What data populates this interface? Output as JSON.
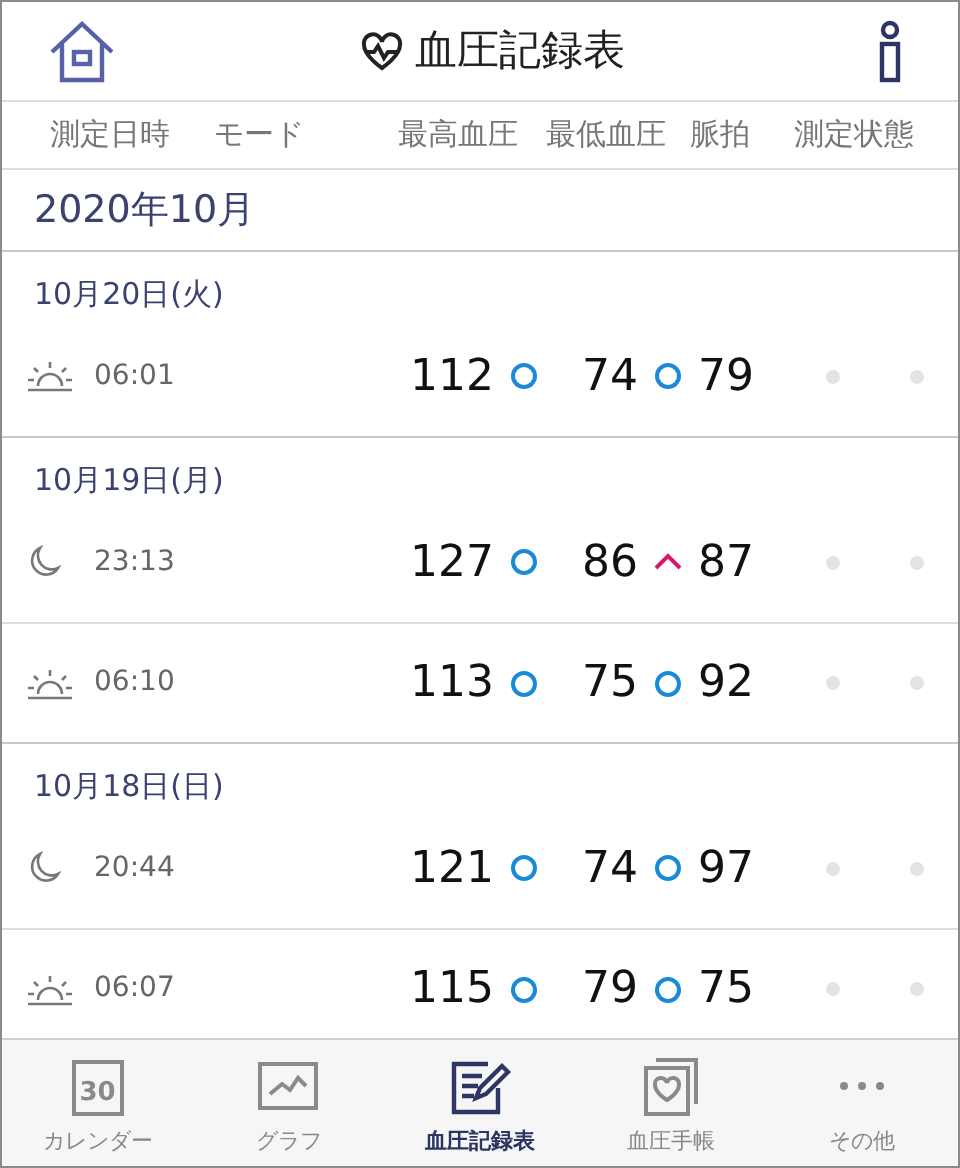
{
  "header": {
    "title": "血圧記録表"
  },
  "columns": [
    "測定日時",
    "モード",
    "最高血圧",
    "最低血圧",
    "脈拍",
    "測定状態"
  ],
  "month": "2020年10月",
  "days": [
    {
      "date": "10月20日(火)",
      "readings": [
        {
          "mode": {
            "kind": "morning"
          },
          "time": "06:01",
          "systolic": {
            "value": "112",
            "kind": "normal"
          },
          "diastolic": {
            "value": "74",
            "kind": "normal"
          },
          "pulse": "79"
        }
      ]
    },
    {
      "date": "10月19日(月)",
      "readings": [
        {
          "mode": {
            "kind": "night"
          },
          "time": "23:13",
          "systolic": {
            "value": "127",
            "kind": "normal"
          },
          "diastolic": {
            "value": "86",
            "kind": "high"
          },
          "pulse": "87"
        },
        {
          "mode": {
            "kind": "morning"
          },
          "time": "06:10",
          "systolic": {
            "value": "113",
            "kind": "normal"
          },
          "diastolic": {
            "value": "75",
            "kind": "normal"
          },
          "pulse": "92"
        }
      ]
    },
    {
      "date": "10月18日(日)",
      "readings": [
        {
          "mode": {
            "kind": "night"
          },
          "time": "20:44",
          "systolic": {
            "value": "121",
            "kind": "normal"
          },
          "diastolic": {
            "value": "74",
            "kind": "normal"
          },
          "pulse": "97"
        },
        {
          "mode": {
            "kind": "morning"
          },
          "time": "06:07",
          "systolic": {
            "value": "115",
            "kind": "normal"
          },
          "diastolic": {
            "value": "79",
            "kind": "normal"
          },
          "pulse": "75"
        }
      ]
    }
  ],
  "tabs": [
    {
      "kind": "calendar",
      "label": "カレンダー",
      "icon_text": "30",
      "selected": false
    },
    {
      "kind": "graph",
      "label": "グラフ",
      "selected": false
    },
    {
      "kind": "record",
      "label": "血圧記録表",
      "selected": true
    },
    {
      "kind": "notebook",
      "label": "血圧手帳",
      "selected": false
    },
    {
      "kind": "more",
      "label": "その他",
      "selected": false
    }
  ]
}
